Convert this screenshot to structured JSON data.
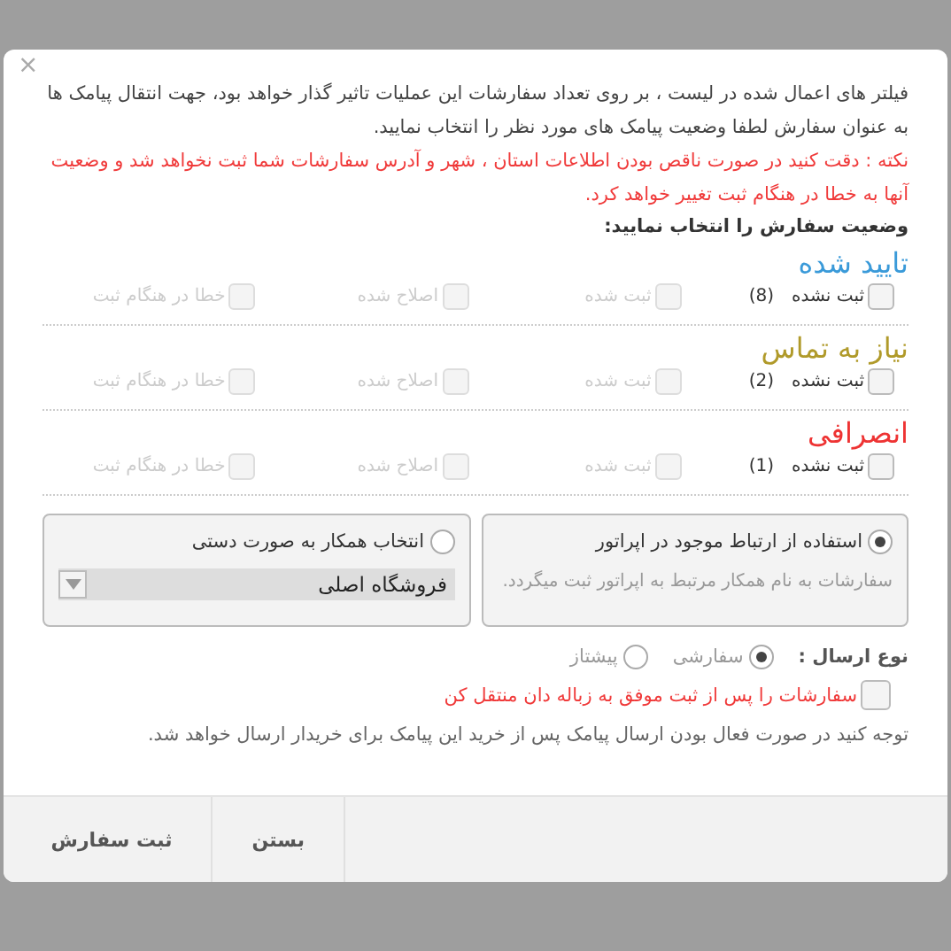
{
  "dialog": {
    "close": "×",
    "intro": "فیلتر های اعمال شده در لیست ، بر روی تعداد سفارشات این عملیات تاثیر گذار خواهد بود، جهت انتقال پیامک ها به عنوان سفارش لطفا وضعیت پیامک های مورد نظر را انتخاب نمایید.",
    "note": "نکته : دقت کنید در صورت ناقص بودن اطلاعات استان ، شهر و آدرس سفارشات شما ثبت نخواهد شد و وضعیت آنها به خطا در هنگام ثبت تغییر خواهد کرد.",
    "prompt": "وضعیت سفارش را انتخاب نمایید:"
  },
  "groups": [
    {
      "title": "تایید شده",
      "color": "#3a9ad9",
      "options": [
        {
          "label": "ثبت نشده",
          "count": "(8)",
          "checked": false,
          "disabled": false
        },
        {
          "label": "ثبت شده",
          "checked": false,
          "disabled": true
        },
        {
          "label": "اصلاح شده",
          "checked": false,
          "disabled": true
        },
        {
          "label": "خطا در هنگام ثبت",
          "checked": false,
          "disabled": true
        }
      ]
    },
    {
      "title": "نیاز به تماس",
      "color": "#b09a2a",
      "options": [
        {
          "label": "ثبت نشده",
          "count": "(2)",
          "checked": false,
          "disabled": false
        },
        {
          "label": "ثبت شده",
          "checked": false,
          "disabled": true
        },
        {
          "label": "اصلاح شده",
          "checked": false,
          "disabled": true
        },
        {
          "label": "خطا در هنگام ثبت",
          "checked": false,
          "disabled": true
        }
      ]
    },
    {
      "title": "انصرافی",
      "color": "#ee3333",
      "options": [
        {
          "label": "ثبت نشده",
          "count": "(1)",
          "checked": false,
          "disabled": false
        },
        {
          "label": "ثبت شده",
          "checked": false,
          "disabled": true
        },
        {
          "label": "اصلاح شده",
          "checked": false,
          "disabled": true
        },
        {
          "label": "خطا در هنگام ثبت",
          "checked": false,
          "disabled": true
        }
      ]
    }
  ],
  "partner": [
    {
      "label": "استفاده از ارتباط موجود در اپراتور",
      "selected": true,
      "kind": "hint",
      "hint": "سفارشات به نام همکار مرتبط به اپراتور ثبت میگردد."
    },
    {
      "label": "انتخاب همکار به صورت دستی",
      "selected": false,
      "kind": "select",
      "value": "فروشگاه اصلی"
    }
  ],
  "send_type": {
    "label": "نوع ارسال :",
    "options": [
      {
        "label": "سفارشی",
        "selected": true
      },
      {
        "label": "پیشتاز",
        "selected": false
      }
    ]
  },
  "move_to_trash": {
    "label": "سفارشات را پس از ثبت موفق به زباله دان منتقل کن",
    "checked": false
  },
  "footnote": "توجه کنید در صورت فعال بودن ارسال پیامک پس از خرید این پیامک برای خریدار ارسال خواهد شد.",
  "buttons": [
    "بستن",
    "ثبت سفارش"
  ]
}
